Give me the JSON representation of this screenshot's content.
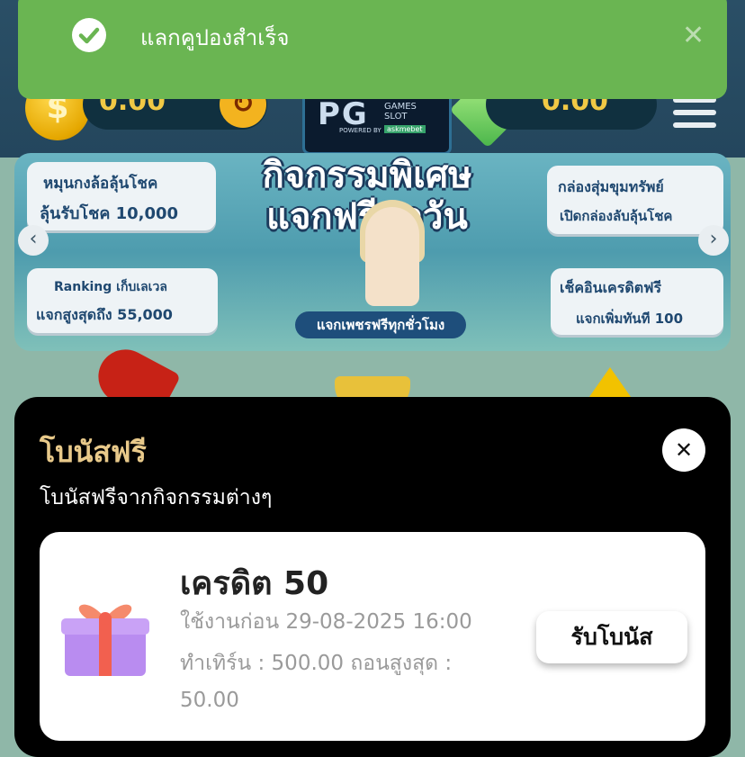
{
  "header": {
    "balance_1": "0.00",
    "balance_2": "0.00",
    "coin_symbol": "$",
    "logo": {
      "mark": "PG",
      "text_1": "GAMES",
      "text_2": "SLOT",
      "powered": "POWERED BY",
      "brand": "askmebet"
    }
  },
  "banner": {
    "headline_1": "กิจกรรมพิเศษ",
    "headline_2": "แจกฟรีทุกวัน",
    "tiles": [
      {
        "title": "หมุนกงล้อลุ้นโชค",
        "subtitle": "ลุ้นรับโชค 10,000"
      },
      {
        "title": "กล่องสุ่มขุมทรัพย์",
        "subtitle": "เปิดกล่องลับลุ้นโชค"
      },
      {
        "title": "Ranking เก็บเลเวล",
        "subtitle": "แจกสูงสุดถึง 55,000"
      },
      {
        "title": "เช็คอินเครดิตฟรี",
        "subtitle": "แจกเพิ่มทันที 100"
      }
    ],
    "hourly": "แจกเพชรฟรีทุกชั่วโมง",
    "prev_icon": "‹",
    "next_icon": "›"
  },
  "toast": {
    "message": "แลกคูปองสำเร็จ",
    "close_icon": "✕",
    "color": "#6ab552"
  },
  "sheet": {
    "title": "โบนัสฟรี",
    "subtitle": "โบนัสฟรีจากกิจกรรมต่างๆ",
    "close_icon": "✕",
    "bonus": {
      "credit": "เครดิต 50",
      "expiry": "ใช้งานก่อน 29-08-2025 16:00",
      "turnover": "ทำเทิร์น : 500.00  ถอนสูงสุด :",
      "max_withdraw": "50.00",
      "claim_label": "รับโบนัส"
    }
  },
  "colors": {
    "title_gold": "#e8c98a",
    "toast_green": "#6ab552",
    "header_bg": "#24465d"
  }
}
